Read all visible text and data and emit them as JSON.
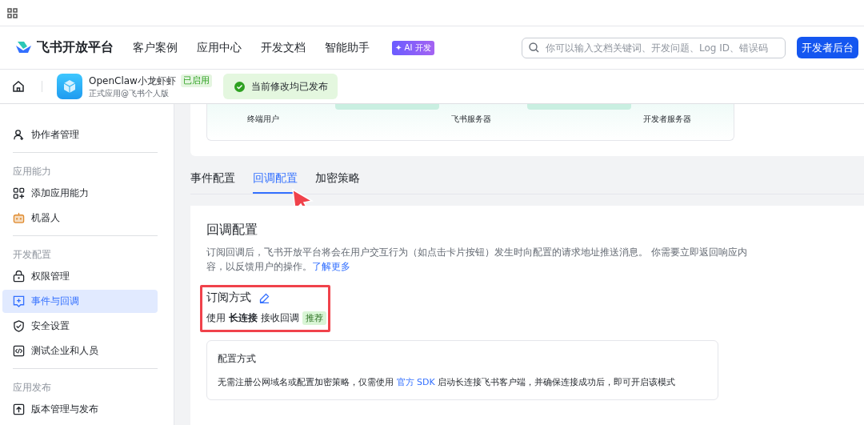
{
  "header": {
    "brand": "飞书开放平台",
    "nav": [
      {
        "label": "客户案例"
      },
      {
        "label": "应用中心"
      },
      {
        "label": "开发文档"
      },
      {
        "label": "智能助手",
        "badge": "✦ AI 开发"
      }
    ],
    "search": {
      "placeholder": "你可以输入文档关键词、开发问题、Log ID、错误码"
    },
    "console_button": "开发者后台"
  },
  "app_bar": {
    "app_name": "OpenClaw小龙虾虾",
    "status": "已启用",
    "subtitle": "正式应用@飞书个人版",
    "toast": "当前修改均已发布"
  },
  "sidebar": {
    "groups": [
      {
        "items": [
          {
            "label": "协作者管理",
            "selected": false
          }
        ]
      },
      {
        "title": "应用能力",
        "items": [
          {
            "label": "添加应用能力",
            "selected": false
          },
          {
            "label": "机器人",
            "selected": false
          }
        ]
      },
      {
        "title": "开发配置",
        "items": [
          {
            "label": "权限管理",
            "selected": false
          },
          {
            "label": "事件与回调",
            "selected": true
          },
          {
            "label": "安全设置",
            "selected": false
          },
          {
            "label": "测试企业和人员",
            "selected": false
          }
        ]
      },
      {
        "title": "应用发布",
        "items": [
          {
            "label": "版本管理与发布",
            "selected": false
          }
        ]
      }
    ]
  },
  "diagram": {
    "nodes": [
      "终端用户",
      "飞书服务器",
      "开发者服务器"
    ]
  },
  "tabs": [
    {
      "label": "事件配置",
      "selected": false
    },
    {
      "label": "回调配置",
      "selected": true
    },
    {
      "label": "加密策略",
      "selected": false
    }
  ],
  "callback": {
    "title": "回调配置",
    "description": "订阅回调后，飞书开放平台将会在用户交互行为（如点击卡片按钮）发生时向配置的请求地址推送消息。 你需要立即返回响应内容，以反馈用户的操作。",
    "learn_more": "了解更多",
    "mode_title": "订阅方式",
    "mode_text": "使用 **长连接** 接收回调",
    "mode_tag": "推荐",
    "config": {
      "title": "配置方式",
      "text_before": "无需注册公网域名或配置加密策略，仅需使用",
      "link": "官方 SDK",
      "text_after": "启动长连接飞书客户端，并确保连接成功后，即可开启该模式"
    }
  }
}
